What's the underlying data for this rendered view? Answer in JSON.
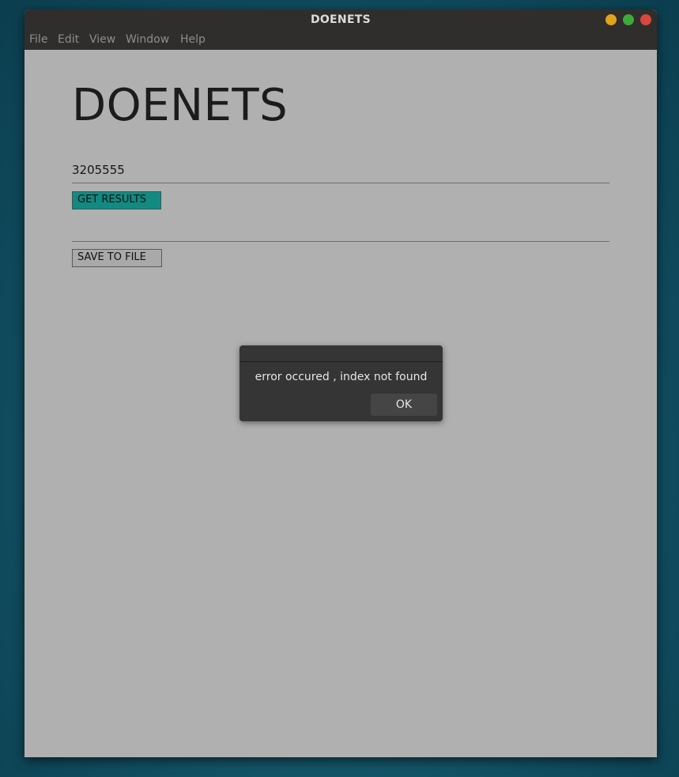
{
  "window": {
    "title": "DOENETS",
    "controls": [
      "minimize",
      "maximize",
      "close"
    ]
  },
  "menu": {
    "items": [
      "File",
      "Edit",
      "View",
      "Window",
      "Help"
    ]
  },
  "main": {
    "heading": "DOENETS",
    "index_input_value": "3205555",
    "get_results_label": "GET RESULTS",
    "results_value": "",
    "save_label": "SAVE TO FILE"
  },
  "dialog": {
    "message": "error occured ,  index not found",
    "ok_label": "OK"
  },
  "colors": {
    "accent_button": "#128a82",
    "window_bg": "#b0b0b0",
    "dialog_bg": "#353535"
  }
}
